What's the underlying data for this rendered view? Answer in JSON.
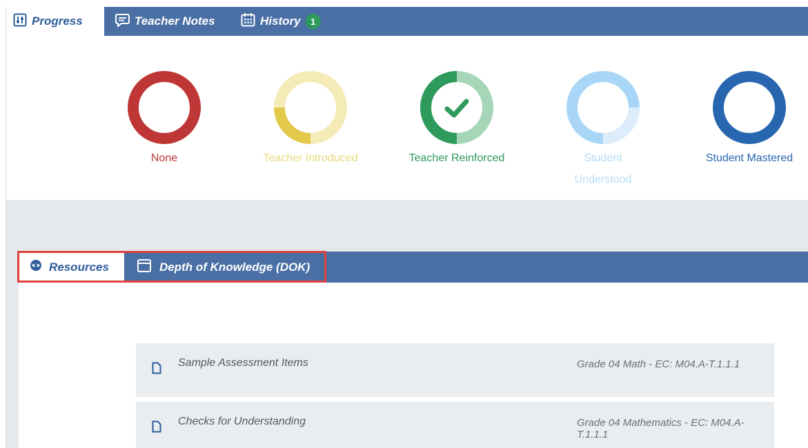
{
  "tabs": [
    {
      "label": "Progress",
      "icon": "sliders-icon"
    },
    {
      "label": "Teacher Notes",
      "icon": "comment-icon"
    },
    {
      "label": "History",
      "icon": "calendar-icon",
      "badge": "1"
    }
  ],
  "levels": [
    {
      "label": "None",
      "color": "#bf3636"
    },
    {
      "label": "Teacher Introduced",
      "color": "#e8d97c"
    },
    {
      "label": "Teacher Reinforced",
      "color": "#2e9a5c"
    },
    {
      "label": "Student Understood",
      "color": "#b4dbf5"
    },
    {
      "label": "Student Mastered",
      "color": "#2966b0"
    }
  ],
  "resource_tabs": [
    {
      "label": "Resources",
      "icon": "eye-icon"
    },
    {
      "label": "Depth of Knowledge (DOK)",
      "icon": "window-icon"
    }
  ],
  "resources": [
    {
      "title": "Sample Assessment Items",
      "standard": "Grade 04 Math - EC: M04.A-T.1.1.1",
      "icon": "document-icon"
    },
    {
      "title": "Checks for Understanding",
      "standard": "Grade 04 Mathematics - EC: M04.A-T.1.1.1",
      "icon": "document-icon"
    }
  ],
  "colors": {
    "bar": "#4a6fa5",
    "highlight": "#e0413c",
    "badge": "#2e9a5c"
  }
}
